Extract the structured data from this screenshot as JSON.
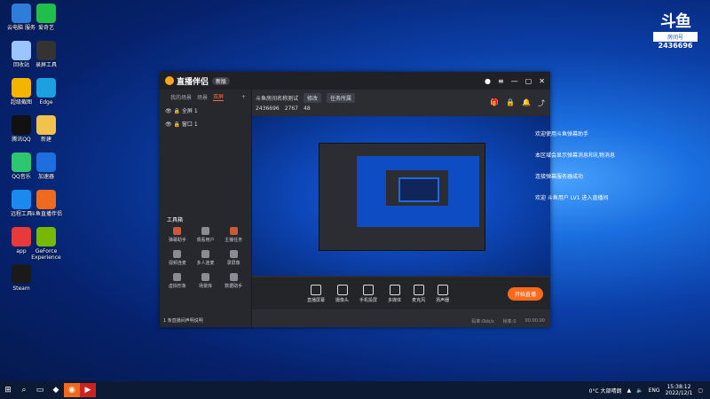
{
  "desktop": {
    "icons": [
      {
        "label": "云电脑\n服务",
        "icon": "app-icon",
        "color": "#2e7dd8"
      },
      {
        "label": "爱奇艺",
        "icon": "iqiyi-icon",
        "color": "#1fbf4a"
      },
      {
        "label": "回收站",
        "icon": "recycle-bin-icon",
        "color": "#9bc5ff"
      },
      {
        "label": "录屏工具",
        "icon": "recorder-icon",
        "color": "#333"
      },
      {
        "label": "超级截图",
        "icon": "app-icon",
        "color": "#f4b400"
      },
      {
        "label": "Edge",
        "icon": "edge-icon",
        "color": "#1ba0e0"
      },
      {
        "label": "腾讯QQ",
        "icon": "qq-icon",
        "color": "#111"
      },
      {
        "label": "新建",
        "icon": "folder-icon",
        "color": "#f2c34c"
      },
      {
        "label": "QQ音乐",
        "icon": "music-icon",
        "color": "#2cc76e"
      },
      {
        "label": "加速器",
        "icon": "app-icon",
        "color": "#1d6fe0"
      },
      {
        "label": "远程工具",
        "icon": "app-icon",
        "color": "#1a8af0"
      },
      {
        "label": "斗鱼直播伴侣",
        "icon": "douyu-icon",
        "color": "#f06a1e"
      },
      {
        "label": "app",
        "icon": "app-icon",
        "color": "#e83a3a"
      },
      {
        "label": "GeForce\nExperience",
        "icon": "nvidia-icon",
        "color": "#76b900"
      },
      {
        "label": "Steam",
        "icon": "steam-icon",
        "color": "#1a1a1a"
      }
    ]
  },
  "watermark": {
    "logo": "斗鱼",
    "sub": "房间号",
    "room": "2436696"
  },
  "app": {
    "title": "直播伴侣",
    "version": "新版",
    "tabs": [
      "我的场景",
      "场景",
      "双屏"
    ],
    "active_tab_index": 2,
    "scenes": [
      "全屏 1",
      "窗口 1"
    ],
    "toolbox_title": "工具箱",
    "tools": [
      {
        "label": "弹幕助手",
        "accent": true
      },
      {
        "label": "观看用户",
        "accent": false
      },
      {
        "label": "主播任务",
        "accent": true
      },
      {
        "label": "视频连麦",
        "accent": false
      },
      {
        "label": "多人连麦",
        "accent": false
      },
      {
        "label": "录屏像",
        "accent": false
      },
      {
        "label": "虚拟形象",
        "accent": false
      },
      {
        "label": "场景库",
        "accent": false
      },
      {
        "label": "数据助手",
        "accent": false
      }
    ],
    "notice": "1 条直播间声明说明",
    "room": {
      "name": "斗鱼房间名称测试",
      "category_btn": "修改",
      "room_id": "2436696",
      "fans": "2767",
      "level": "48",
      "action_btn": "任务所属"
    },
    "controls": [
      "直播屏幕",
      "摄像头",
      "手机投屏",
      "多媒体",
      "麦克风",
      "扬声器"
    ],
    "start_button": "开始直播",
    "status": [
      "码率:0kb/s",
      "帧率:0",
      "00:00:00"
    ]
  },
  "messages": [
    "欢迎使用斗鱼弹幕助手",
    "本区域会显示弹幕消息和礼物消息",
    "连接弹幕服务器成功",
    "欢迎 斗鱼用户 LV1 进入直播间"
  ],
  "taskbar": {
    "weather": "0°C 大部晴朗",
    "lang": "ENG",
    "time": "15:38:12",
    "date": "2022/12/1"
  }
}
